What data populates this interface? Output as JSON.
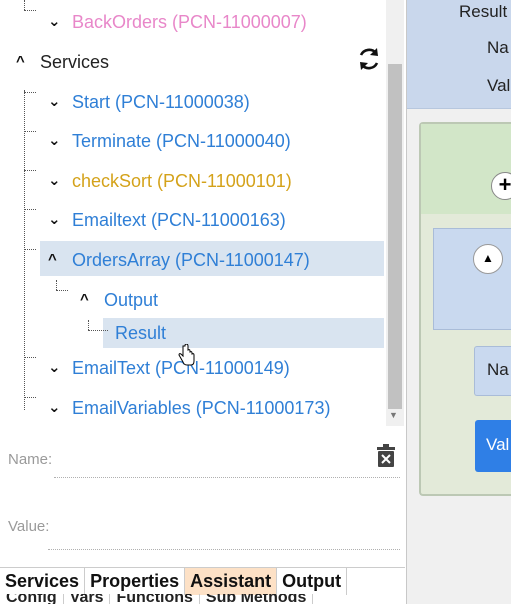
{
  "tree": {
    "rows": [
      {
        "id": "backorders",
        "chev": "⌄",
        "label": "BackOrders (PCN-11000007)",
        "color": "pink"
      },
      {
        "id": "services",
        "chev": "^",
        "label": "Services",
        "color": "dark"
      },
      {
        "id": "start",
        "chev": "⌄",
        "label": "Start (PCN-11000038)",
        "color": "blue"
      },
      {
        "id": "terminate",
        "chev": "⌄",
        "label": "Terminate (PCN-11000040)",
        "color": "blue"
      },
      {
        "id": "checksort",
        "chev": "⌄",
        "label": "checkSort (PCN-11000101)",
        "color": "gold"
      },
      {
        "id": "emailtext1",
        "chev": "⌄",
        "label": "Emailtext (PCN-11000163)",
        "color": "blue"
      },
      {
        "id": "ordersarray",
        "chev": "^",
        "label": "OrdersArray (PCN-11000147)",
        "color": "blue"
      },
      {
        "id": "output",
        "chev": "^",
        "label": "Output",
        "color": "blue"
      },
      {
        "id": "result",
        "chev": "",
        "label": "Result",
        "color": "blue"
      },
      {
        "id": "emailtext2",
        "chev": "⌄",
        "label": "EmailText (PCN-11000149)",
        "color": "blue"
      },
      {
        "id": "emailvariables",
        "chev": "⌄",
        "label": "EmailVariables (PCN-11000173)",
        "color": "blue"
      }
    ]
  },
  "fields": {
    "name_label": "Name:",
    "value_label": "Value:"
  },
  "tabs": {
    "row1": [
      "Services",
      "Properties",
      "Assistant",
      "Output"
    ],
    "active": "Assistant",
    "row2": [
      "Config",
      "Vars",
      "Functions",
      "Sub Methods"
    ]
  },
  "right_panel": {
    "result_text": "Result",
    "name_short": "Na",
    "value_short": "Val",
    "name_short2": "Na",
    "value_button": "Val"
  },
  "colors": {
    "blue": "#2f7fd6",
    "pink": "#e887c9",
    "gold": "#d4a21a",
    "selection": "#d9e4f0",
    "active_tab": "#fde1c6",
    "value_button": "#2f7fe6"
  },
  "icons": [
    "refresh-icon",
    "trash-icon",
    "hand-cursor-icon",
    "plus-icon",
    "chevron-up-icon"
  ]
}
